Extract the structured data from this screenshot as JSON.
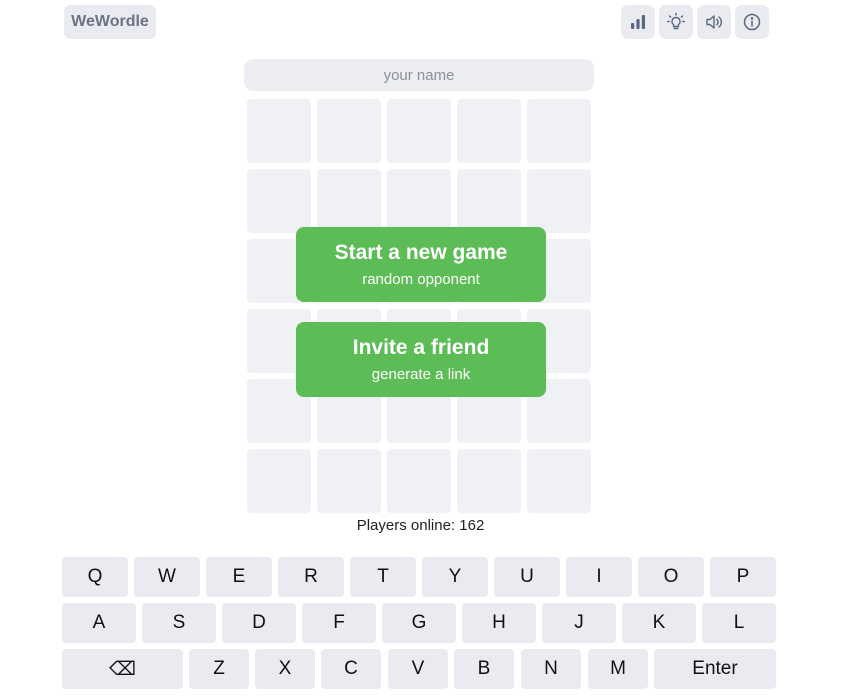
{
  "header": {
    "logo": "WeWordle",
    "icons": [
      "stats-icon",
      "hint-icon",
      "sound-icon",
      "info-icon"
    ]
  },
  "name_input": {
    "placeholder": "your name",
    "value": ""
  },
  "actions": {
    "new_game_title": "Start a new game",
    "new_game_sub": "random opponent",
    "invite_title": "Invite a friend",
    "invite_sub": "generate a link"
  },
  "status": {
    "online": "Players online: 162"
  },
  "keyboard": {
    "row1": [
      "Q",
      "W",
      "E",
      "R",
      "T",
      "Y",
      "U",
      "I",
      "O",
      "P"
    ],
    "row2": [
      "A",
      "S",
      "D",
      "F",
      "G",
      "H",
      "J",
      "K",
      "L"
    ],
    "row3": [
      "⌫",
      "Z",
      "X",
      "C",
      "V",
      "B",
      "N",
      "M",
      "Enter"
    ]
  },
  "colors": {
    "accent": "#5cbc56",
    "tile": "#f0f1f4",
    "key": "#e9ebf0"
  }
}
